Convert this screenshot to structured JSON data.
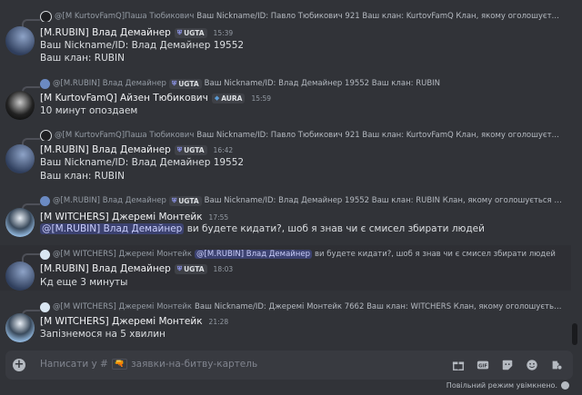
{
  "messages": [
    {
      "reply": {
        "name": "@[M KurtovFamQ]Паша Тюбикович",
        "text": "Ваш Nickname/ID: Павло Тюбикович 921 Ваш клан: KurtovFamQ  Клан, якому оголошується битва:"
      },
      "author": "[M.RUBIN] Влад Демайнер",
      "tag": "UGTA",
      "time": "15:39",
      "lines": [
        "Ваш Nickname/ID: Влад Демайнер 19552",
        "Ваш клан:  RUBIN"
      ]
    },
    {
      "reply": {
        "name": "@[M.RUBIN] Влад Демайнер",
        "tag": "UGTA",
        "text": "Ваш Nickname/ID: Влад Демайнер 19552 Ваш клан:  RUBIN"
      },
      "author": "[M KurtovFamQ] Айзен Тюбикович",
      "tag": "AURA",
      "time": "15:59",
      "lines": [
        "10 минут опоздаем"
      ]
    },
    {
      "reply": {
        "name": "@[M KurtovFamQ]Паша Тюбикович",
        "text": "Ваш Nickname/ID: Павло Тюбикович 921 Ваш клан: KurtovFamQ  Клан, якому оголошується битва: ..."
      },
      "author": "[M.RUBIN] Влад Демайнер",
      "tag": "UGTA",
      "time": "16:42",
      "lines": [
        "Ваш Nickname/ID: Влад Демайнер 19552",
        "Ваш клан:  RUBIN"
      ]
    },
    {
      "reply": {
        "name": "@[M.RUBIN] Влад Демайнер",
        "tag": "UGTA",
        "text": "Ваш Nickname/ID: Влад Демайнер 19552 Ваш клан: RUBIN Клан, якому оголошується битва: ..."
      },
      "author": "[M WITCHERS] Джеремі Монтейк",
      "time": "17:55",
      "mention": "@[M.RUBIN] Влад Демайнер",
      "lines": [
        "ви будете кидати?, шоб я знав чи є смисел збирати людей"
      ]
    },
    {
      "reply": {
        "name": "@[M WITCHERS] Джеремі Монтейк",
        "mention": "@[M.RUBIN] Влад Демайнер",
        "text": "ви будете кидати?, шоб я знав чи є смисел збирати людей"
      },
      "author": "[M.RUBIN] Влад Демайнер",
      "tag": "UGTA",
      "time": "18:03",
      "lines": [
        "Кд еще 3 минуты"
      ]
    },
    {
      "reply": {
        "name": "@[M WITCHERS] Джеремі Монтейк",
        "text": "Ваш Nickname/ID: Джеремі Монтейк 7662 Ваш клан: WITCHERS Клан, якому оголошується битва:  R..."
      },
      "author": "[M WITCHERS] Джеремі Монтейк",
      "time": "21:28",
      "lines": [
        "Запізнемося на 5 хвилин"
      ]
    }
  ],
  "composer": {
    "placeholder_prefix": "Написати у #",
    "channel_emoji": "🔫",
    "channel": "заявки-на-битву-картель"
  },
  "tools": [
    "gift-icon",
    "gif-icon",
    "sticker-icon",
    "emoji-icon",
    "apps-icon"
  ],
  "slowmode": "Повільний режим увімкнено."
}
